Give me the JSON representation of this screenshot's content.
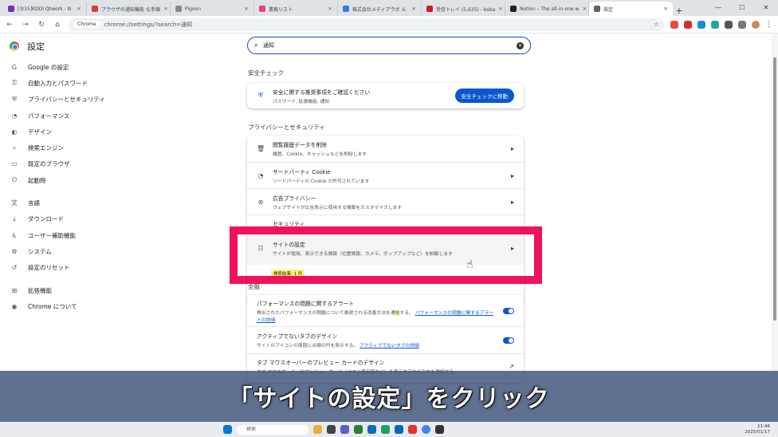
{
  "tabs": [
    {
      "label": "[3/15]KDDI Qtwork - N",
      "color": "#7a2fb8"
    },
    {
      "label": "ブラウザの通知機能 な手順",
      "color": "#d43f3a"
    },
    {
      "label": "Pigeon",
      "color": "#888888"
    },
    {
      "label": "業務リスト",
      "color": "#e8437a"
    },
    {
      "label": "株式会社メディアラボ ル",
      "color": "#3b7bd8"
    },
    {
      "label": "受信トレイ (5,635) - koba",
      "color": "#c5221f"
    },
    {
      "label": "Notion – The all-in-one w",
      "color": "#222222"
    },
    {
      "label": "設定",
      "color": "#5f6368"
    }
  ],
  "window": {
    "minimize": "—",
    "maximize": "☐",
    "close": "✕"
  },
  "toolbar": {
    "chip": "Chrome",
    "url": "chrome://settings/?search=通知"
  },
  "sidebar": {
    "title": "設定",
    "items": [
      {
        "icon": "G",
        "label": "Google の設定"
      },
      {
        "icon": "⚿",
        "label": "自動入力とパスワード"
      },
      {
        "icon": "⛨",
        "label": "プライバシーとセキュリティ"
      },
      {
        "icon": "◔",
        "label": "パフォーマンス"
      },
      {
        "icon": "◐",
        "label": "デザイン"
      },
      {
        "icon": "⌕",
        "label": "検索エンジン"
      },
      {
        "icon": "▭",
        "label": "既定のブラウザ"
      },
      {
        "icon": "⏻",
        "label": "起動時"
      },
      {
        "icon": "文",
        "label": "言語"
      },
      {
        "icon": "⤓",
        "label": "ダウンロード"
      },
      {
        "icon": "♿",
        "label": "ユーザー補助機能"
      },
      {
        "icon": "⚙",
        "label": "システム"
      },
      {
        "icon": "↺",
        "label": "設定のリセット"
      },
      {
        "icon": "⊞",
        "label": "拡張機能"
      },
      {
        "icon": "◉",
        "label": "Chrome について"
      }
    ]
  },
  "search": {
    "value": "通知"
  },
  "safety": {
    "section_title": "安全チェック",
    "title": "安全に関する推奨事項をご確認ください",
    "subtitle": "パスワード, 拡張機能, 通知",
    "button": "安全チェックに移動"
  },
  "privacy": {
    "section_title": "プライバシーとセキュリティ",
    "rows": [
      {
        "title": "閲覧履歴データを削除",
        "sub": "履歴、Cookie、キャッシュなどを削除します"
      },
      {
        "title": "サードパーティ Cookie",
        "sub": "リードパーティの Cookie が許可されています"
      },
      {
        "title": "広告プライバシー",
        "sub": "ウェブサイトが広告表示に使用する情報をカスタマイズします"
      }
    ],
    "partial_label": "セキュリティ",
    "site_row": {
      "title": "サイトの設定",
      "sub": "サイトが使用、表示できる情報（位置情報、カメラ、ポップアップなど）を制御します"
    },
    "notification_chip": "検索結果: 1 件"
  },
  "system": {
    "section_title": "全般",
    "rows": [
      {
        "title": "パフォーマンスの問題に関するアラート",
        "sub_a": "検出されたパフォーマンスの問題について推奨される改善方法を通",
        "sub_hl": "知",
        "sub_b": "する。",
        "link": "パフォーマンスの問題に関するアラートの詳細"
      },
      {
        "title": "アクティブでないタブのデザイン",
        "sub_a": "サイトのアイコンの周囲に点線の円を表示する。",
        "link": "アクティブでないタブの詳細"
      },
      {
        "title": "タブ マウスオーバーのプレビュー カードのデザイン",
        "sub_a": "タブ マウスオーバーのプレビュー カード（メモリ使用量など）を表示するかどうかを選択する"
      }
    ]
  },
  "caption": "「サイトの設定」をクリック",
  "taskbar": {
    "search": "検索",
    "time": "11:46",
    "date": "2025/01/17"
  }
}
